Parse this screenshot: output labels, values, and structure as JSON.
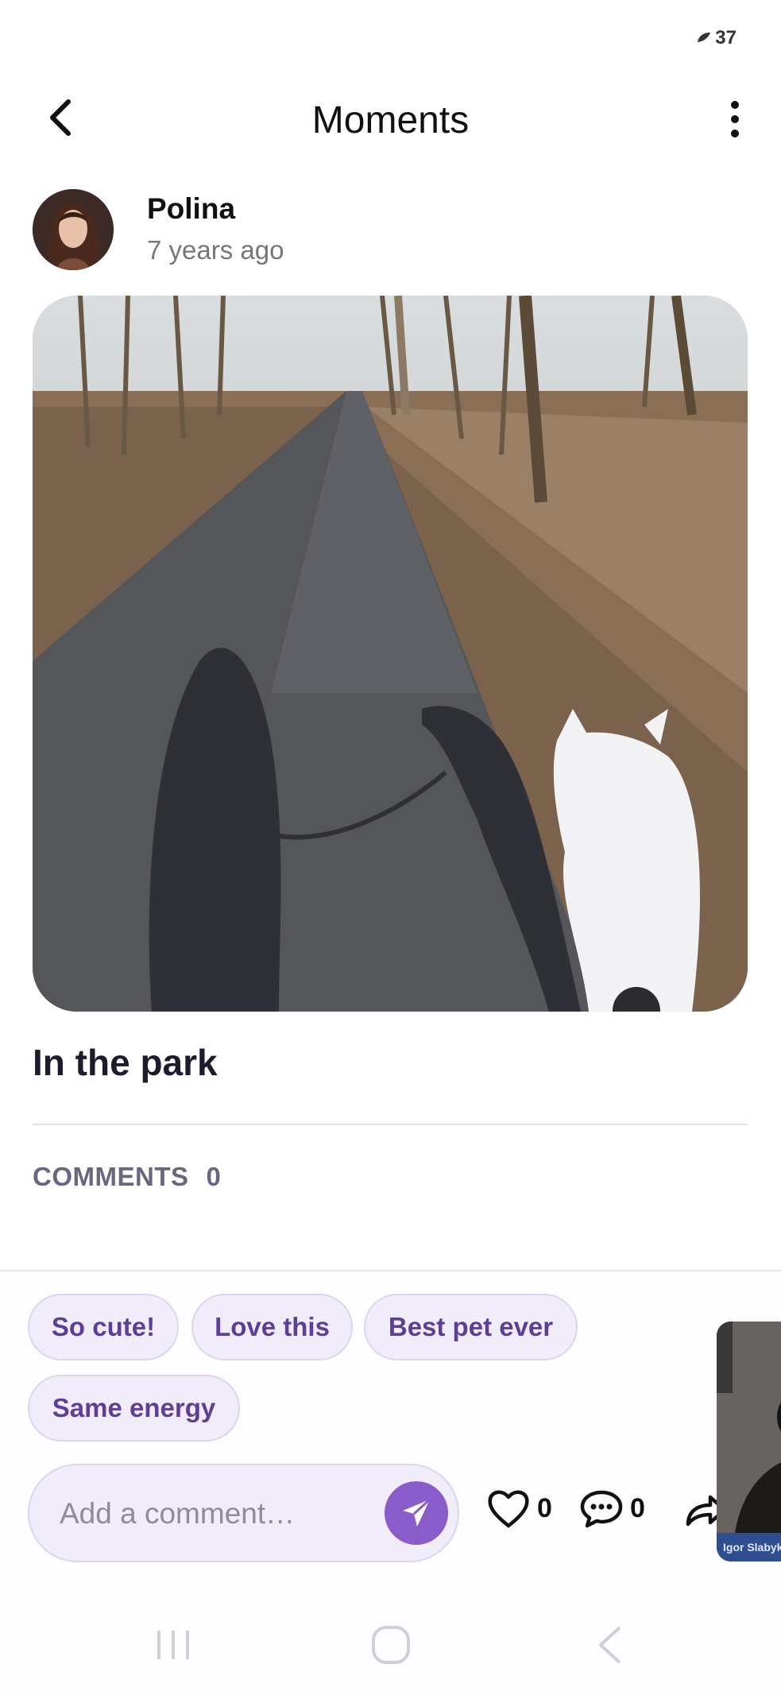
{
  "status_bar": {
    "battery": "37",
    "battery_icon": "leaf-battery-icon"
  },
  "app_bar": {
    "title": "Moments",
    "back_icon": "chevron-left-icon",
    "more_icon": "more-vertical-icon"
  },
  "post": {
    "author_name": "Polina",
    "time_ago": "7 years ago",
    "image_alt": "shadows of person and dog on park path",
    "caption": "In the park"
  },
  "comments": {
    "label": "COMMENTS",
    "count": "0"
  },
  "quick_replies": [
    "So cute!",
    "Love this",
    "Best pet ever",
    "Same energy"
  ],
  "composer": {
    "placeholder": "Add a comment…",
    "send_icon": "send-icon"
  },
  "actions": {
    "likes": "0",
    "comments": "0",
    "like_icon": "heart-icon",
    "comment_icon": "comment-icon",
    "share_icon": "share-icon"
  },
  "floating_video": {
    "name": "Igor Slabyk"
  },
  "colors": {
    "accent": "#8a5cc9",
    "chip_bg": "#f0ecfa",
    "chip_text": "#5e3f96",
    "muted": "#6b6680"
  }
}
